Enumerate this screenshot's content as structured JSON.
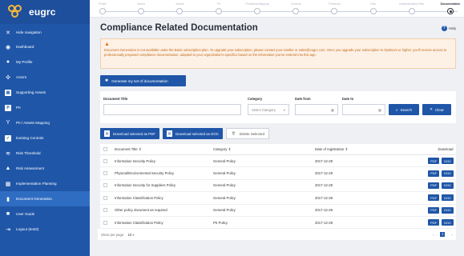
{
  "app": {
    "logo_text": "eugrc"
  },
  "sidebar": {
    "hide_label": "Hide navigation",
    "items": [
      {
        "label": "Dashboard",
        "icon": "dashboard-icon"
      },
      {
        "label": "My Profile",
        "icon": "user-icon"
      },
      {
        "label": "Actors",
        "icon": "actors-icon"
      },
      {
        "label": "Supporting Assets",
        "icon": "assets-icon"
      },
      {
        "label": "PII",
        "icon": "pii-icon"
      },
      {
        "label": "PII / Assets Mapping",
        "icon": "mapping-icon"
      },
      {
        "label": "Existing Controls",
        "icon": "checkbox-icon"
      },
      {
        "label": "Risk Threshold",
        "icon": "threshold-icon"
      },
      {
        "label": "Risk Assessment",
        "icon": "warning-icon"
      },
      {
        "label": "Implementation Planning",
        "icon": "planning-icon"
      },
      {
        "label": "Document Generation",
        "icon": "document-icon"
      },
      {
        "label": "User Guide",
        "icon": "book-icon"
      },
      {
        "label": "Logout (test3)",
        "icon": "logout-icon"
      }
    ],
    "active_index": 10
  },
  "stepper": {
    "steps": [
      "Profile",
      "Actors",
      "Assets",
      "PII",
      "PII/Assets Mapping",
      "Controls",
      "Threshold",
      "Risk",
      "Implementation Plan",
      "Documentation"
    ],
    "current_index": 9
  },
  "page": {
    "title": "Compliance Related Documentation",
    "help_label": "Help"
  },
  "warning": {
    "icon": "warning-icon",
    "text": "Document Generation is not available under the Basic subscription plan. To upgrade your subscription, please contact your reseller or sales@eugrc.com. Once you upgrade your subscription to Optimum or higher, you'll receive access to professionally prepared compliance documentation, adapted to your organization's specifics based on the information you've entered into this app."
  },
  "generate_button": "Generate my set of documentation",
  "filters": {
    "title_label": "Document Title",
    "title_value": "",
    "category_label": "Category",
    "category_selected": "Select Category",
    "date_from_label": "Date from",
    "date_to_label": "Date to",
    "search_label": "Search",
    "clear_label": "Clear"
  },
  "bulk_actions": {
    "pdf": "Download selected as PDF",
    "doc": "Download selected as DOC",
    "delete": "Delete Selected"
  },
  "table": {
    "headers": {
      "title": "Document Title",
      "category": "Category",
      "date": "Date of registration",
      "download": "Download"
    },
    "pdf_label": "PDF",
    "doc_label": "DOC",
    "rows": [
      {
        "title": "Information Security Policy",
        "category": "General Policy",
        "date": "2017-12-28"
      },
      {
        "title": "Physical/Environmental Security Policy",
        "category": "General Policy",
        "date": "2017-12-28"
      },
      {
        "title": "Information Security for Suppliers Policy",
        "category": "General Policy",
        "date": "2017-12-28"
      },
      {
        "title": "Information Classification Policy",
        "category": "General Policy",
        "date": "2017-12-28"
      },
      {
        "title": "Other policy document as required",
        "category": "General Policy",
        "date": "2017-12-28"
      },
      {
        "title": "Information Classification Policy",
        "category": "PII Policy",
        "date": "2017-12-28"
      }
    ]
  },
  "pagination": {
    "per_page_label": "Show per page:",
    "per_page_value": "10",
    "current_page": "1"
  },
  "colors": {
    "brand": "#1f56a8",
    "warning_text": "#c36b1b",
    "warning_bg": "#fdf1e6"
  }
}
